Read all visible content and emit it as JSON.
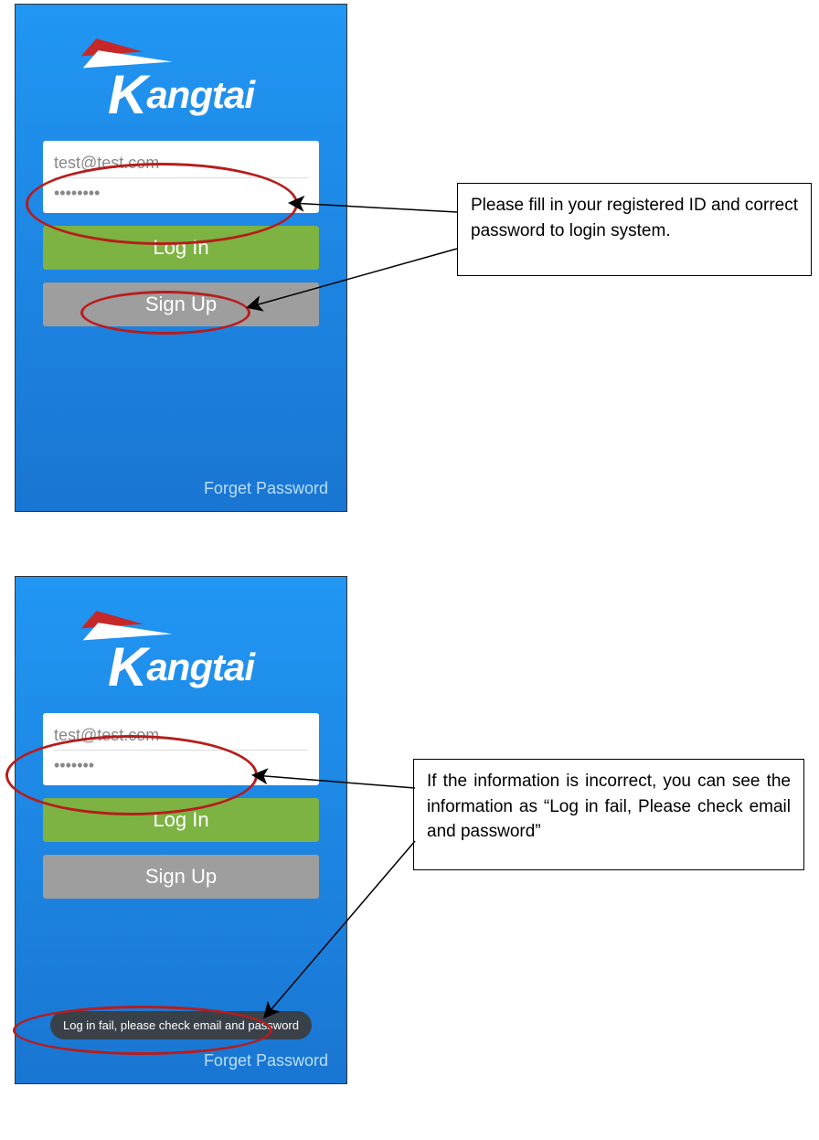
{
  "screen1": {
    "brand": "Kangtai",
    "email": "test@test.com",
    "password": "••••••••",
    "login_label": "Log In",
    "signup_label": "Sign Up",
    "forget_label": "Forget Password"
  },
  "screen2": {
    "brand": "Kangtai",
    "email": "test@test.com",
    "password": "•••••••",
    "login_label": "Log In",
    "signup_label": "Sign Up",
    "forget_label": "Forget Password",
    "toast": "Log in fail, please check email and password"
  },
  "callouts": {
    "c1": "Please fill in your registered ID and correct password to login system.",
    "c2": "If the information is incorrect, you can see the information as “Log in fail, Please check email and password”"
  }
}
